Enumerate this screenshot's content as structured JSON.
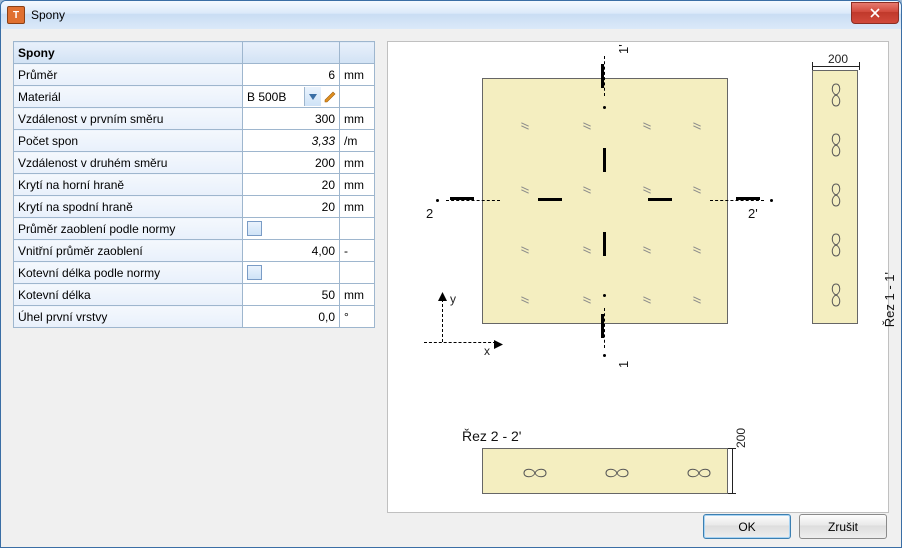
{
  "window": {
    "title": "Spony"
  },
  "table": {
    "header": "Spony",
    "rows": [
      {
        "label": "Průměr",
        "value": "6",
        "unit": "mm",
        "type": "num"
      },
      {
        "label": "Materiál",
        "value": "B 500B",
        "unit": "",
        "type": "combo"
      },
      {
        "label": "Vzdálenost v prvním směru",
        "value": "300",
        "unit": "mm",
        "type": "num"
      },
      {
        "label": "Počet spon",
        "value": "3,33",
        "unit": "/m",
        "type": "italic"
      },
      {
        "label": "Vzdálenost v druhém směru",
        "value": "200",
        "unit": "mm",
        "type": "num"
      },
      {
        "label": "Krytí na horní hraně",
        "value": "20",
        "unit": "mm",
        "type": "num"
      },
      {
        "label": "Krytí na spodní hraně",
        "value": "20",
        "unit": "mm",
        "type": "num"
      },
      {
        "label": "Průměr zaoblení podle normy",
        "value": "",
        "unit": "",
        "type": "check"
      },
      {
        "label": "Vnitřní průměr zaoblení",
        "value": "4,00",
        "unit": "-",
        "type": "num"
      },
      {
        "label": "Kotevní délka podle normy",
        "value": "",
        "unit": "",
        "type": "check"
      },
      {
        "label": "Kotevní délka",
        "value": "50",
        "unit": "mm",
        "type": "num"
      },
      {
        "label": "Úhel první vrstvy",
        "value": "0,0",
        "unit": "°",
        "type": "num"
      }
    ]
  },
  "diagram": {
    "dim_top": "200",
    "dim_side": "200",
    "section_v_label": "Řez 1 - 1'",
    "section_h_label": "Řez 2 - 2'",
    "mark_1a": "1",
    "mark_1b": "1'",
    "mark_2a": "2",
    "mark_2b": "2'",
    "axis_x": "x",
    "axis_y": "y"
  },
  "buttons": {
    "ok": "OK",
    "cancel": "Zrušit"
  }
}
